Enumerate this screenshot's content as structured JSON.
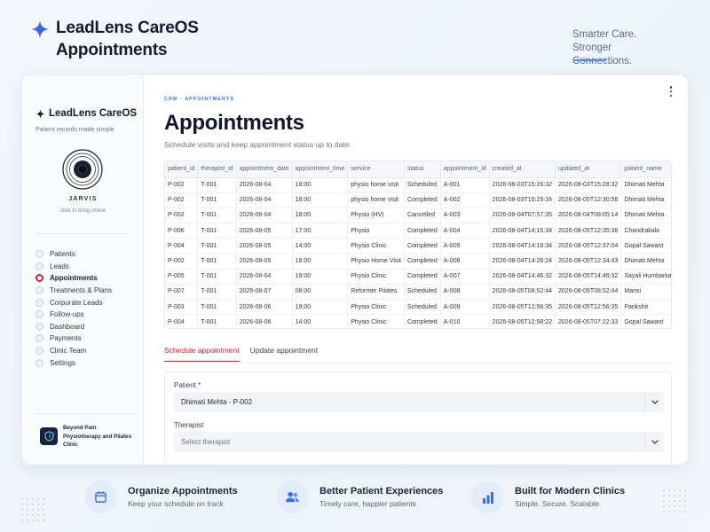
{
  "hero": {
    "brand": "LeadLens CareOS",
    "page": "Appointments",
    "tagline_1": "Smarter Care.",
    "tagline_2": "Stronger Connections.",
    "accent": "#3a6fe0"
  },
  "sidebar": {
    "brand": "LeadLens CareOS",
    "subtitle": "Patient records made simple",
    "assistant_name": "JARVIS",
    "assistant_hint": "click to bring online",
    "items": [
      {
        "label": "Patients"
      },
      {
        "label": "Leads"
      },
      {
        "label": "Appointments",
        "active": true
      },
      {
        "label": "Treatments & Plans"
      },
      {
        "label": "Corporate Leads"
      },
      {
        "label": "Follow-ups"
      },
      {
        "label": "Dashboard"
      },
      {
        "label": "Payments"
      },
      {
        "label": "Clinic Team"
      },
      {
        "label": "Settings"
      }
    ],
    "clinic_name": "Beyond Pain Physiotherapy and Pilates Clinic",
    "active_color": "#d91f2a"
  },
  "main": {
    "breadcrumb": "CRM · APPOINTMENTS",
    "title": "Appointments",
    "subtitle": "Schedule visits and keep appointment status up to date.",
    "table": {
      "columns": [
        "patient_id",
        "therapist_id",
        "appointment_date",
        "appointment_time",
        "service",
        "status",
        "appointment_id",
        "created_at",
        "updated_at",
        "patient_name"
      ],
      "rows": [
        [
          "P-002",
          "T-001",
          "2026-08-04",
          "18:00",
          "physio home visit",
          "Scheduled",
          "A-001",
          "2026-08-03T15:28:32",
          "2026-08-03T15:28:32",
          "Dhimati Mehta"
        ],
        [
          "P-002",
          "T-001",
          "2026-08-04",
          "18:00",
          "physio home visit",
          "Completed",
          "A-002",
          "2026-08-03T15:29:16",
          "2026-08-05T12:30:56",
          "Dhimati Mehta"
        ],
        [
          "P-002",
          "T-001",
          "2026-08-04",
          "18:00",
          "Physio (HV)",
          "Cancelled",
          "A-003",
          "2026-08-04T07:57:35",
          "2026-08-04T08:05:14",
          "Dhimati Mehta"
        ],
        [
          "P-006",
          "T-001",
          "2026-08-05",
          "17:00",
          "Physio",
          "Completed",
          "A-004",
          "2026-08-04T14:15:34",
          "2026-08-05T12:35:36",
          "Chandrakala"
        ],
        [
          "P-004",
          "T-001",
          "2026-08-05",
          "14:00",
          "Physio Clinic",
          "Completed",
          "A-005",
          "2026-08-04T14:18:34",
          "2026-08-05T12:37:04",
          "Gopal Sawant"
        ],
        [
          "P-002",
          "T-001",
          "2026-08-05",
          "18:00",
          "Physio Home Visit",
          "Completed",
          "A-006",
          "2026-08-04T14:26:24",
          "2026-08-05T12:34:43",
          "Dhimati Mehta"
        ],
        [
          "P-005",
          "T-001",
          "2026-08-04",
          "19:00",
          "Physio Clinic",
          "Completed",
          "A-007",
          "2026-08-04T14:46:32",
          "2026-08-05T14:46:32",
          "Sayali Humbarkar"
        ],
        [
          "P-007",
          "T-001",
          "2026-08-07",
          "08:00",
          "Reformer Pilates",
          "Scheduled",
          "A-008",
          "2026-08-05T08:52:44",
          "2026-08-05T08:52:44",
          "Mansi"
        ],
        [
          "P-003",
          "T-001",
          "2026-08-06",
          "19:00",
          "Physio Clinic",
          "Scheduled",
          "A-009",
          "2026-08-05T12:56:35",
          "2026-08-05T12:56:35",
          "Parikshit"
        ],
        [
          "P-004",
          "T-001",
          "2026-08-06",
          "14:00",
          "Physio Clinic",
          "Completed",
          "A-010",
          "2026-08-05T12:58:22",
          "2026-08-05T07:22:33",
          "Gopal Sawant"
        ]
      ]
    },
    "tabs": [
      {
        "label": "Schedule appointment",
        "active": true
      },
      {
        "label": "Update appointment"
      }
    ],
    "form": {
      "patient_label": "Patient *",
      "patient_value": "Dhimati Mehta - P-002",
      "therapist_label": "Therapist",
      "therapist_placeholder": "Select therapist"
    }
  },
  "features": [
    {
      "title": "Organize Appointments",
      "subtitle": "Keep your schedule on track",
      "icon": "calendar-icon"
    },
    {
      "title": "Better Patient Experiences",
      "subtitle": "Timely care, happier patients",
      "icon": "users-icon"
    },
    {
      "title": "Built for Modern Clinics",
      "subtitle": "Simple. Secure. Scalable.",
      "icon": "bar-chart-icon"
    }
  ]
}
